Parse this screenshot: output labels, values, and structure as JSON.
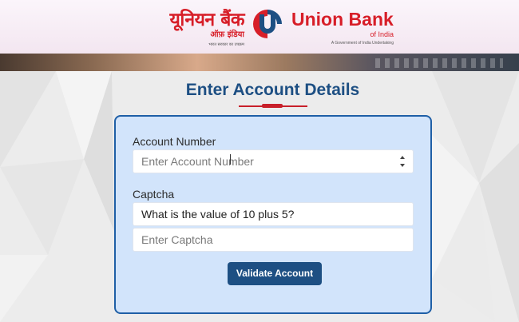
{
  "header": {
    "logo_hindi": {
      "main": "यूनियन बैंक",
      "sub": "ऑफ़ इंडिया",
      "tagline": "भारत सरकार का उपक्रम"
    },
    "logo_english": {
      "main": "Union Bank",
      "sub": "of India",
      "tagline": "A Government of India Undertaking"
    },
    "brand_colors": {
      "red": "#d71e28",
      "blue": "#1d4f83"
    }
  },
  "page": {
    "title": "Enter Account Details"
  },
  "form": {
    "account_number": {
      "label": "Account Number",
      "value": "",
      "placeholder": "Enter Account Number"
    },
    "captcha": {
      "label": "Captcha",
      "question": "What is the value of 10 plus 5?",
      "value": "",
      "placeholder": "Enter Captcha"
    },
    "submit_label": "Validate Account"
  }
}
